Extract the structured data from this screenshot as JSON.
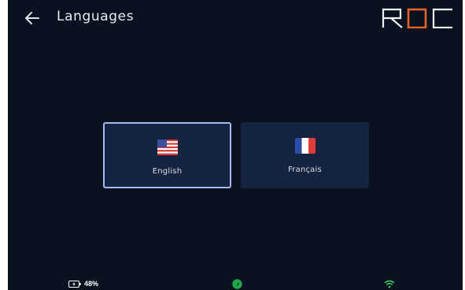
{
  "header": {
    "title": "Languages",
    "back_icon": "arrow-left-icon",
    "logo_text": "ROC"
  },
  "languages": [
    {
      "label": "English",
      "flag": "us-flag-icon",
      "selected": true
    },
    {
      "label": "Français",
      "flag": "fr-flag-icon",
      "selected": false
    }
  ],
  "status": {
    "battery_percent": "48%",
    "battery_icon": "battery-charging-icon",
    "gps_icon": "gps-icon",
    "wifi_icon": "wifi-icon"
  },
  "colors": {
    "background": "#0a1220",
    "card": "#142440",
    "selected_border": "#a7b7f0",
    "accent": "#e8622c",
    "gps": "#1fa84b",
    "wifi": "#39d96a"
  }
}
